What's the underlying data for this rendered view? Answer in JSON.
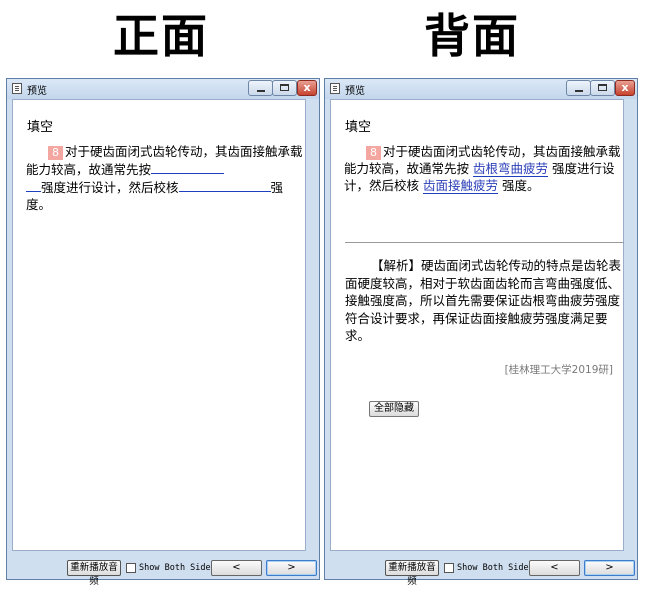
{
  "labels": {
    "front": "正面",
    "back": "背面"
  },
  "window": {
    "title": "预览",
    "minimize_icon": "minimize-icon",
    "maximize_icon": "maximize-icon",
    "close_glyph": "x"
  },
  "question": {
    "heading": "填空",
    "number": "8",
    "text_part1": "对于硬齿面闭式齿轮传动，其齿面接触承载能力较高，故通常先按",
    "text_part2": "强度进行设计，然后校核",
    "text_part3": "强度。",
    "answer1": "齿根弯曲疲劳",
    "answer2": "齿面接触疲劳"
  },
  "analysis": {
    "text": "【解析】硬齿面闭式齿轮传动的特点是齿轮表面硬度较高，相对于软齿面齿轮而言弯曲强度低、接触强度高，所以首先需要保证齿根弯曲疲劳强度符合设计要求，再保证齿面接触疲劳强度满足要求。",
    "source": "[桂林理工大学2019研]",
    "hide_all_button": "全部隐藏"
  },
  "footer": {
    "replay_button": "重新播放音频",
    "show_both_label": "Show Both Sides",
    "prev_glyph": "<",
    "next_glyph": ">"
  }
}
